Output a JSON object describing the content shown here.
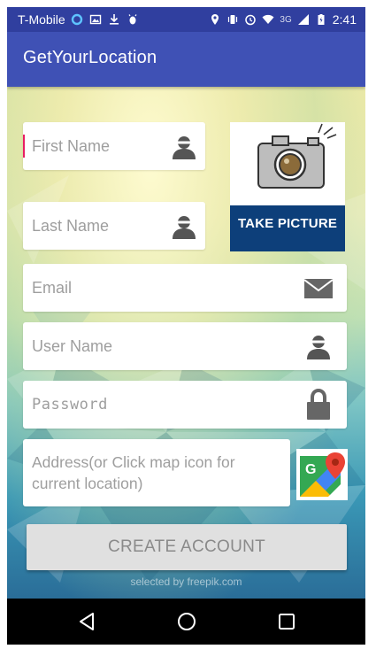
{
  "status_bar": {
    "carrier": "T-Mobile",
    "network": "3G",
    "time": "2:41"
  },
  "app_bar": {
    "title": "GetYourLocation"
  },
  "form": {
    "first_name": {
      "placeholder": "First Name",
      "icon": "person-icon"
    },
    "last_name": {
      "placeholder": "Last Name",
      "icon": "person-icon"
    },
    "email": {
      "placeholder": "Email",
      "icon": "envelope-icon"
    },
    "username": {
      "placeholder": "User Name",
      "icon": "person-icon"
    },
    "password": {
      "placeholder": "Password",
      "icon": "lock-icon"
    },
    "address": {
      "placeholder_line1": "Address(or Click map icon for",
      "placeholder_line2": "current location)"
    }
  },
  "take_picture": {
    "label": "TAKE PICTURE",
    "icon": "camera-icon"
  },
  "map_button": {
    "icon": "google-maps-icon"
  },
  "create_account": {
    "label": "CREATE ACCOUNT"
  },
  "credit": {
    "text": "selected by freepik.com"
  },
  "colors": {
    "status_bar": "#303f9f",
    "app_bar": "#3f51b5",
    "cursor": "#e91e63",
    "take_picture_banner": "#0d3f7a"
  }
}
